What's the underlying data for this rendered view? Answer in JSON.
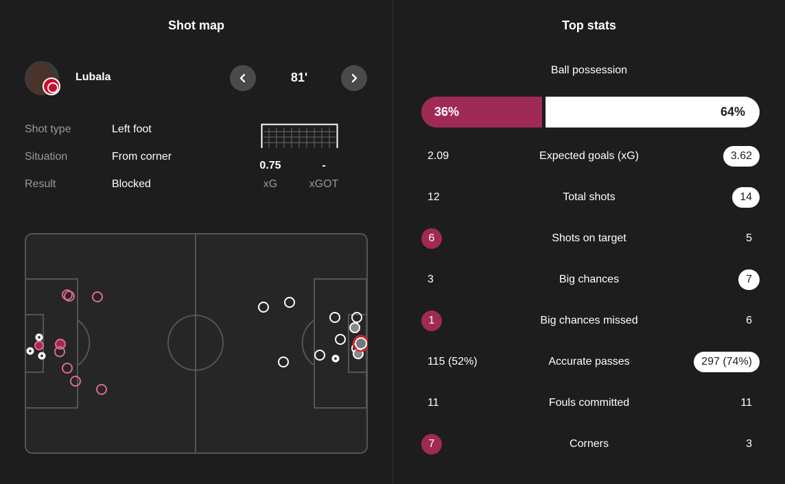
{
  "shot_map": {
    "title": "Shot map",
    "player": {
      "name": "Lubala"
    },
    "minute": "81'",
    "details": [
      {
        "label": "Shot type",
        "value": "Left foot"
      },
      {
        "label": "Situation",
        "value": "From corner"
      },
      {
        "label": "Result",
        "value": "Blocked"
      }
    ],
    "metrics": [
      {
        "value": "0.75",
        "label": "xG"
      },
      {
        "value": "-",
        "label": "xGOT"
      }
    ]
  },
  "top_stats": {
    "title": "Top stats",
    "possession": {
      "label": "Ball possession",
      "home": "36%",
      "away": "64%",
      "home_share": 0.36
    },
    "rows": [
      {
        "label": "Expected goals (xG)",
        "home": "2.09",
        "away": "3.62",
        "highlight": "away"
      },
      {
        "label": "Total shots",
        "home": "12",
        "away": "14",
        "highlight": "away"
      },
      {
        "label": "Shots on target",
        "home": "6",
        "away": "5",
        "highlight": "home"
      },
      {
        "label": "Big chances",
        "home": "3",
        "away": "7",
        "highlight": "away"
      },
      {
        "label": "Big chances missed",
        "home": "1",
        "away": "6",
        "highlight": "home"
      },
      {
        "label": "Accurate passes",
        "home": "115 (52%)",
        "away": "297 (74%)",
        "highlight": "away"
      },
      {
        "label": "Fouls committed",
        "home": "11",
        "away": "11",
        "highlight": "none"
      },
      {
        "label": "Corners",
        "home": "7",
        "away": "3",
        "highlight": "home"
      }
    ]
  },
  "colors": {
    "background": "#1d1d1d",
    "home_accent": "#a02a56",
    "home_shot": "#e06b8b",
    "away_accent": "#ffffff",
    "pitch_fill": "#262626",
    "pitch_lines": "#555555",
    "selected_ring": "#e0212f"
  }
}
